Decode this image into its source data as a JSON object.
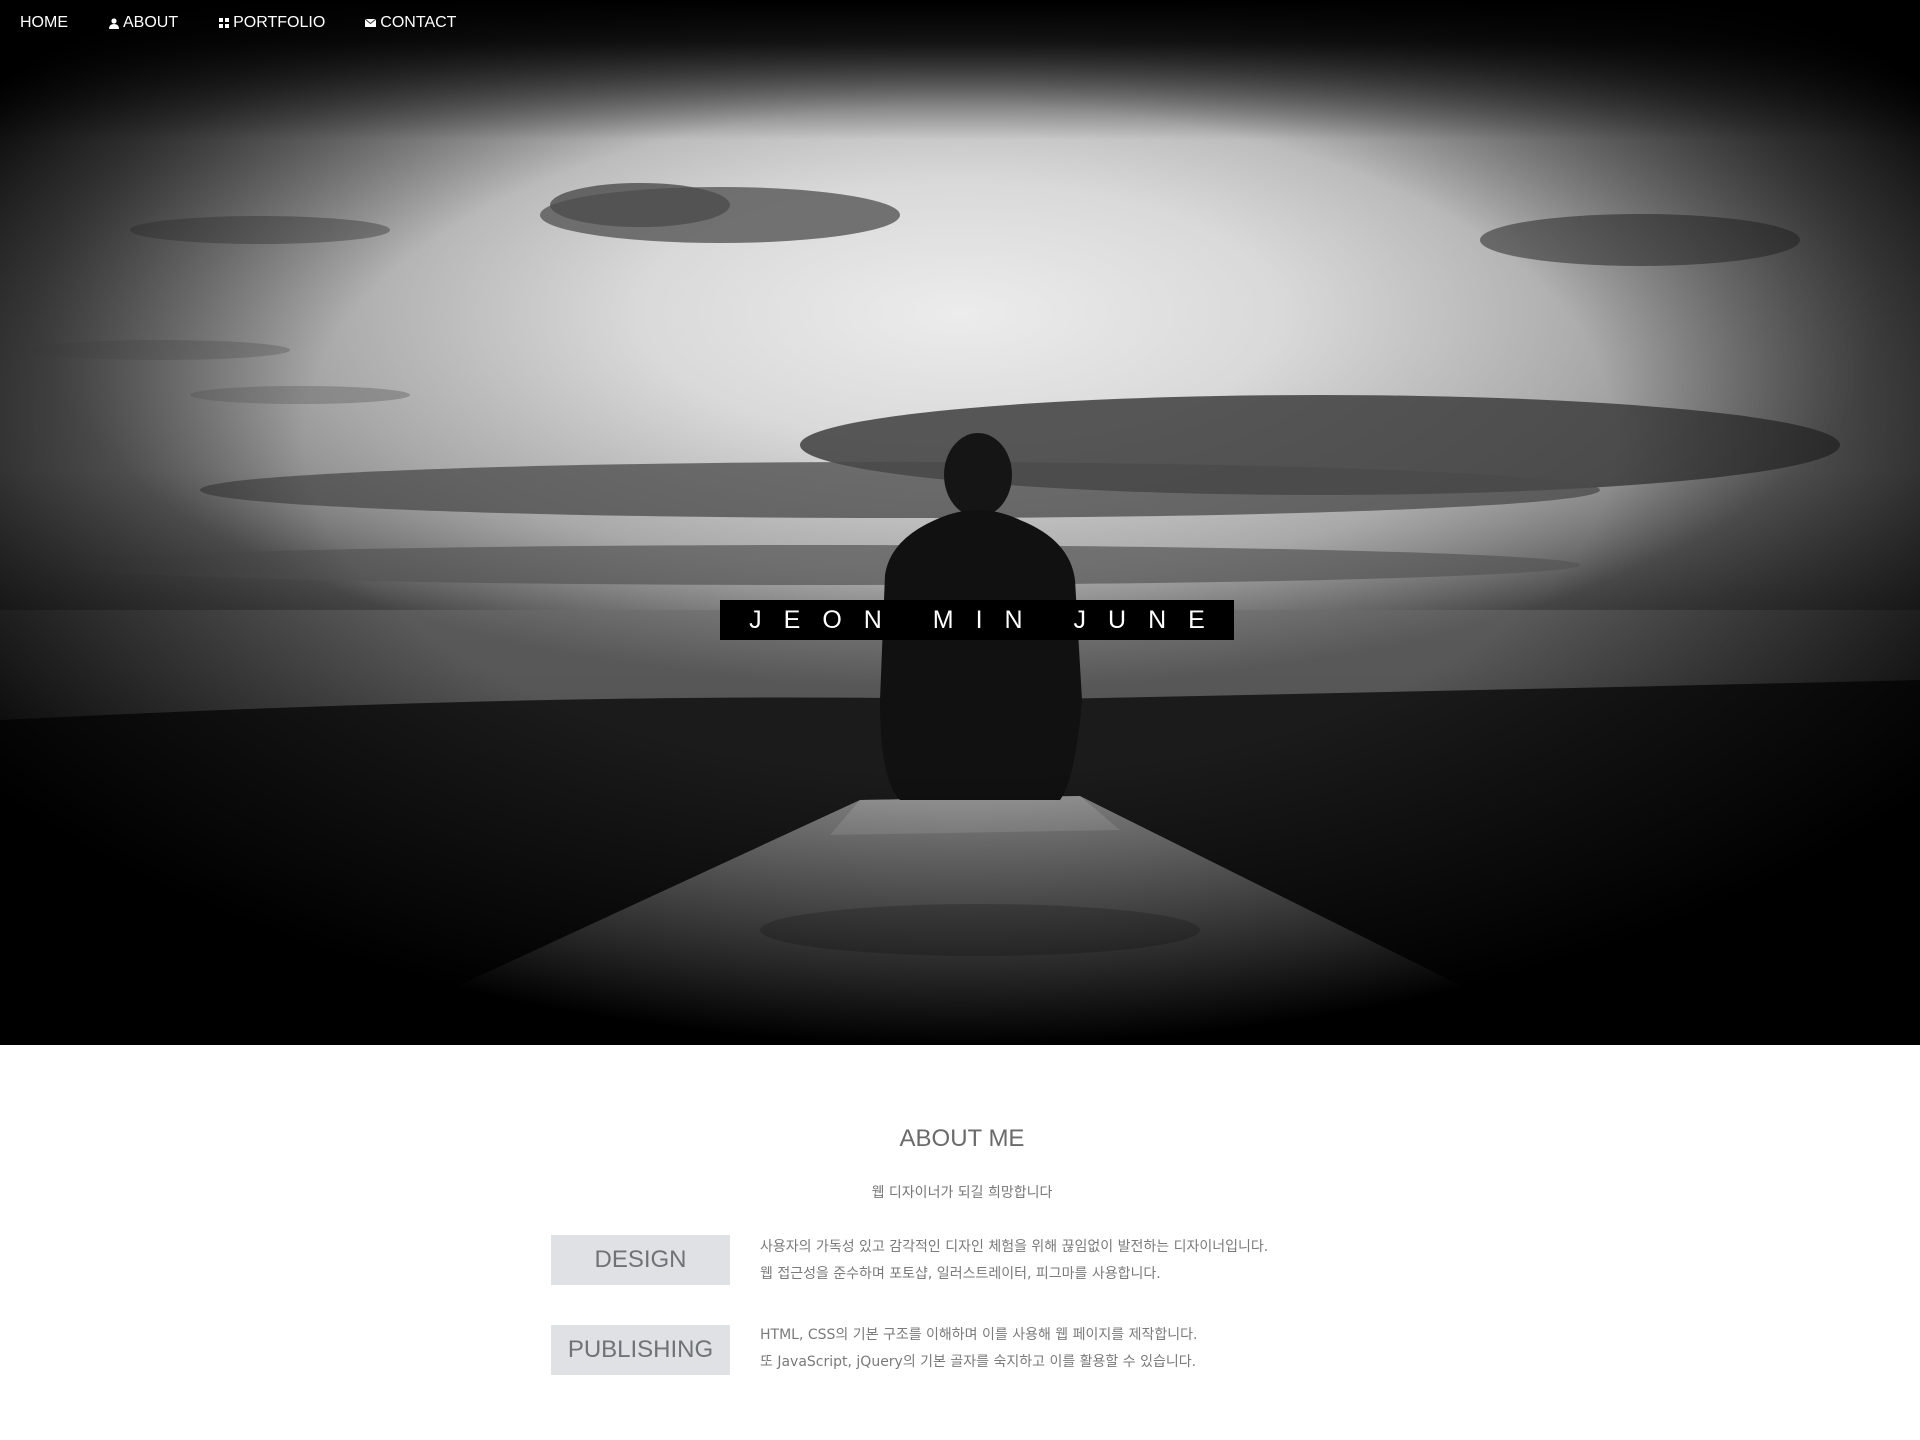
{
  "nav": {
    "items": [
      {
        "label": "HOME",
        "icon": ""
      },
      {
        "label": "ABOUT",
        "icon": "user-icon"
      },
      {
        "label": "PORTFOLIO",
        "icon": "grid-icon"
      },
      {
        "label": "CONTACT",
        "icon": "envelope-icon"
      }
    ]
  },
  "hero": {
    "title": "JEON MIN JUNE"
  },
  "about": {
    "title": "ABOUT ME",
    "subtitle": "웹 디자이너가 되길 희망합니다",
    "skills": [
      {
        "name": "DESIGN",
        "lines": [
          "사용자의 가독성 있고 감각적인 디자인 체험을 위해 끊임없이 발전하는 디자이너입니다.",
          "웹 접근성을 준수하며 포토샵, 일러스트레이터, 피그마를 사용합니다."
        ]
      },
      {
        "name": "PUBLISHING",
        "lines": [
          "HTML, CSS의 기본 구조를 이해하며 이를 사용해 웹 페이지를 제작합니다.",
          "또 JavaScript, jQuery의 기본 골자를 숙지하고 이를 활용할 수 있습니다."
        ]
      }
    ]
  },
  "colors": {
    "badge_bg": "#dfe1e5",
    "title_bg": "#000000",
    "text_gray": "#7a7a7a"
  }
}
